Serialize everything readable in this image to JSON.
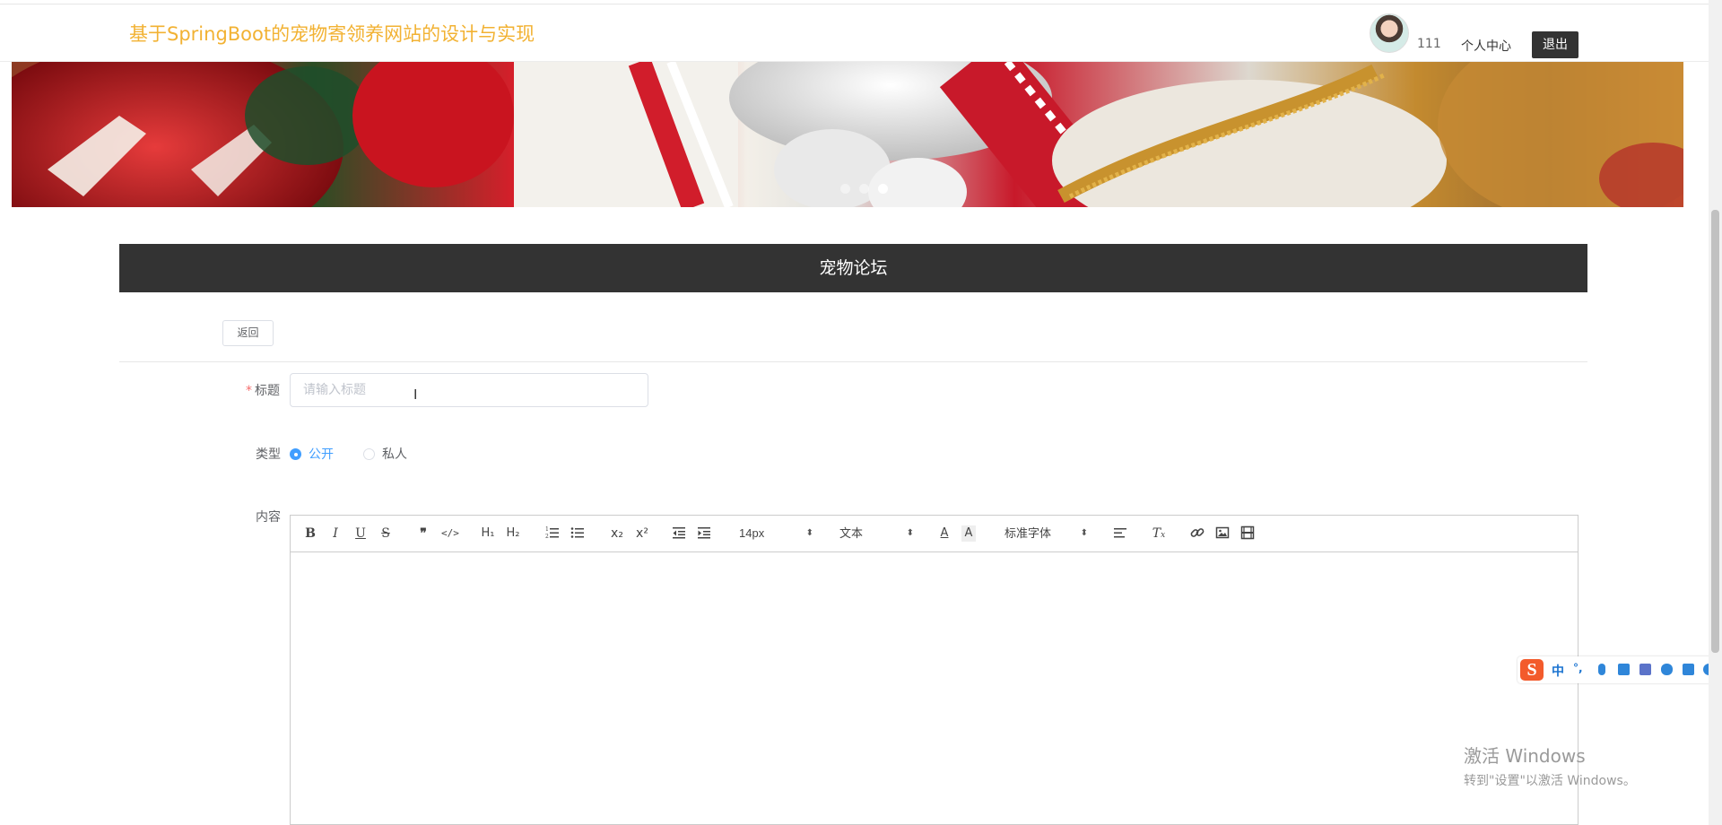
{
  "header": {
    "site_title": "基于SpringBoot的宠物寄领养网站的设计与实现",
    "username": "111",
    "personal_center": "个人中心",
    "logout": "退出"
  },
  "banner": {
    "slide_count": 3,
    "active_slide": 3
  },
  "forum": {
    "title": "宠物论坛"
  },
  "form": {
    "back_label": "返回",
    "title_label": "标题",
    "title_required": "*",
    "title_placeholder": "请输入标题",
    "title_value": "",
    "type_label": "类型",
    "type_options": [
      "公开",
      "私人"
    ],
    "type_selected": "公开",
    "content_label": "内容"
  },
  "editor": {
    "font_size": "14px",
    "header_select": "文本",
    "font_family": "标准字体"
  },
  "ime": {
    "mode": "中",
    "punct": "°,"
  },
  "watermark": {
    "line1": "激活 Windows",
    "line2": "转到\"设置\"以激活 Windows。"
  }
}
